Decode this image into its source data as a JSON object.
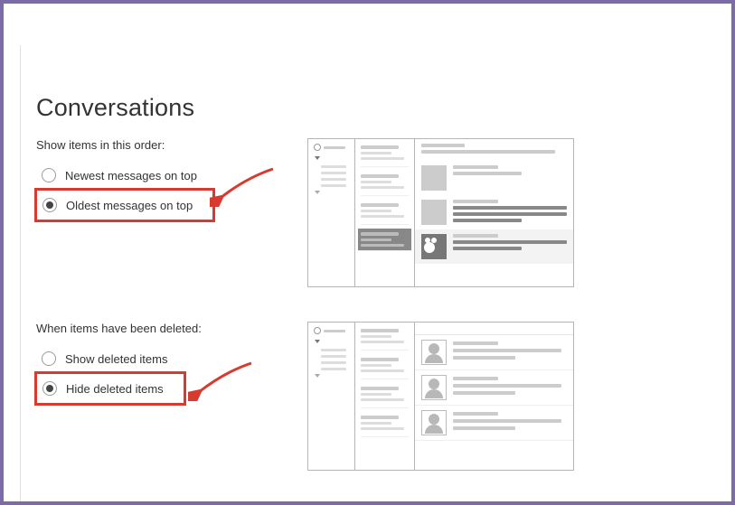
{
  "heading": "Conversations",
  "order_section": {
    "label": "Show items in this order:",
    "options": [
      {
        "label": "Newest messages on top",
        "selected": false,
        "highlighted": false
      },
      {
        "label": "Oldest messages on top",
        "selected": true,
        "highlighted": true
      }
    ]
  },
  "deleted_section": {
    "label": "When items have been deleted:",
    "options": [
      {
        "label": "Show deleted items",
        "selected": false,
        "highlighted": false
      },
      {
        "label": "Hide deleted items",
        "selected": true,
        "highlighted": true
      }
    ]
  }
}
